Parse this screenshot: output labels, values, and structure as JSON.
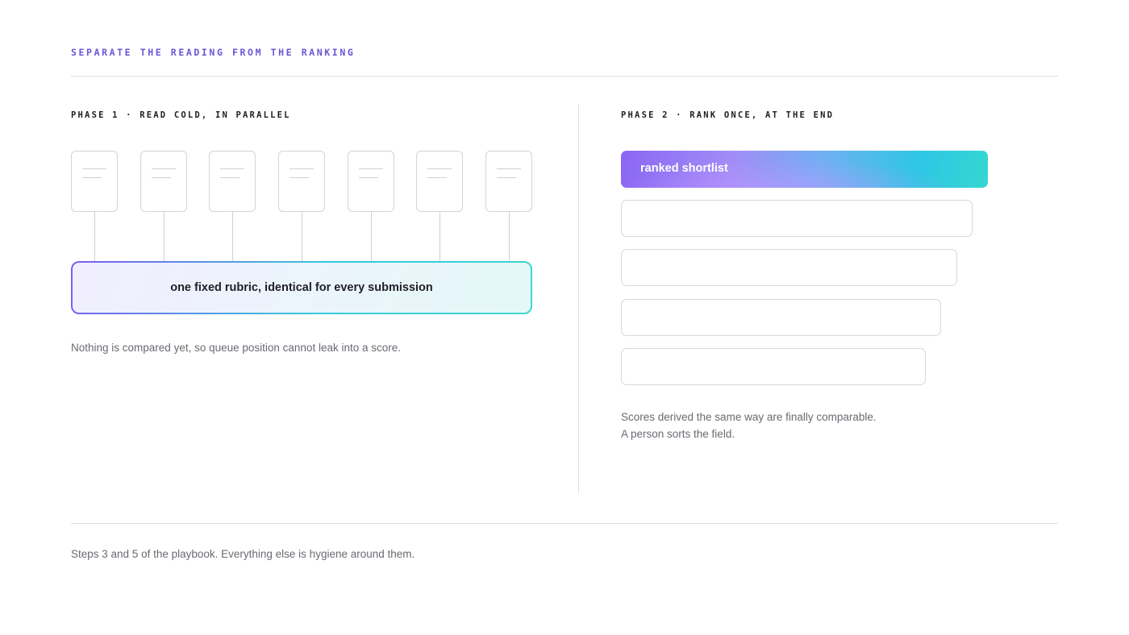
{
  "header": {
    "eyebrow": "SEPARATE THE READING FROM THE RANKING"
  },
  "phase1": {
    "label": "PHASE 1 · READ COLD, IN PARALLEL",
    "submission_count": 7,
    "rubric_label": "one fixed rubric, identical for every submission",
    "note": "Nothing is compared yet, so queue position cannot leak into a score."
  },
  "phase2": {
    "label": "PHASE 2 · RANK ONCE, AT THE END",
    "shortlist_label": "ranked shortlist",
    "rank_slot_count": 4,
    "note_line1": "Scores derived the same way are finally comparable.",
    "note_line2": "A person sorts the field."
  },
  "footer": {
    "text": "Steps 3 and 5 of the playbook. Everything else is hygiene around them."
  },
  "colors": {
    "accent": "#6b55d6",
    "gradient_start": "#7a5cf0",
    "gradient_end": "#3ed6cf",
    "border": "#d4d4da",
    "muted_text": "#6a6a72"
  }
}
